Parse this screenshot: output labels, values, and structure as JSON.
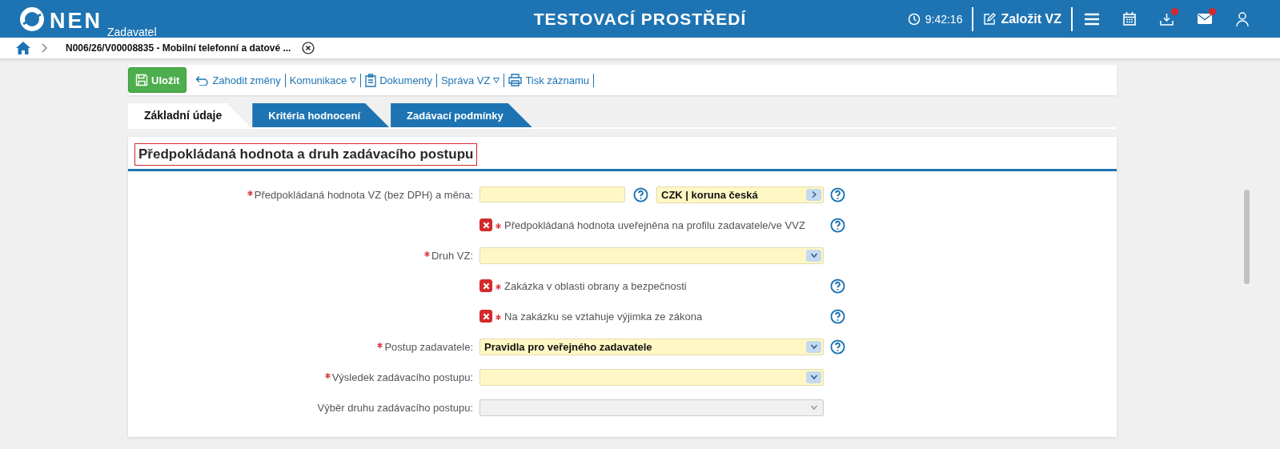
{
  "header": {
    "logo_text": "NEN",
    "logo_subtitle": "Zadavatel",
    "environment": "TESTOVACÍ PROSTŘEDÍ",
    "time": "9:42:16",
    "create_button": "Založit VZ",
    "download_badge": true,
    "mail_badge": true
  },
  "breadcrumb": {
    "current": "N006/26/V00008835 - Mobilní telefonní a datové ..."
  },
  "toolbar": [
    {
      "kind": "save",
      "label": "Uložit",
      "has_menu": false
    },
    {
      "kind": "undo",
      "label": "Zahodit změny",
      "has_menu": false
    },
    {
      "kind": "plain",
      "label": "Komunikace",
      "has_menu": true
    },
    {
      "kind": "clipboard",
      "label": "Dokumenty",
      "has_menu": false
    },
    {
      "kind": "plain",
      "label": "Správa VZ",
      "has_menu": true
    },
    {
      "kind": "print",
      "label": "Tisk záznamu",
      "has_menu": false
    }
  ],
  "tabs": [
    {
      "label": "Základní údaje",
      "selected": true
    },
    {
      "label": "Kritéria hodnocení",
      "selected": false
    },
    {
      "label": "Zadávací podmínky",
      "selected": false
    }
  ],
  "section": {
    "title": "Předpokládaná hodnota a druh zadávacího postupu",
    "rows": [
      {
        "kind": "value_currency",
        "label": "Předpokládaná hodnota VZ (bez DPH) a měna:",
        "required": true,
        "value": "",
        "currency": "CZK | koruna česká",
        "help": true
      },
      {
        "kind": "checkbox",
        "label": "Předpokládaná hodnota uveřejněna na profilu zadavatele/ve VVZ",
        "required": true,
        "crossed": true,
        "help": true
      },
      {
        "kind": "select",
        "label": "Druh VZ:",
        "required": true,
        "value": "",
        "disabled": false,
        "help": false
      },
      {
        "kind": "checkbox",
        "label": "Zakázka v oblasti obrany a bezpečnosti",
        "required": true,
        "crossed": true,
        "help": true
      },
      {
        "kind": "checkbox",
        "label": "Na zakázku se vztahuje výjimka ze zákona",
        "required": true,
        "crossed": true,
        "help": true
      },
      {
        "kind": "select",
        "label": "Postup zadavatele:",
        "required": true,
        "value": "Pravidla pro veřejného zadavatele",
        "disabled": false,
        "help": true
      },
      {
        "kind": "select",
        "label": "Výsledek zadávacího postupu:",
        "required": true,
        "value": "",
        "disabled": false,
        "help": false
      },
      {
        "kind": "select",
        "label": "Výběr druhu zadávacího postupu:",
        "required": false,
        "value": "",
        "disabled": true,
        "help": false
      }
    ]
  }
}
